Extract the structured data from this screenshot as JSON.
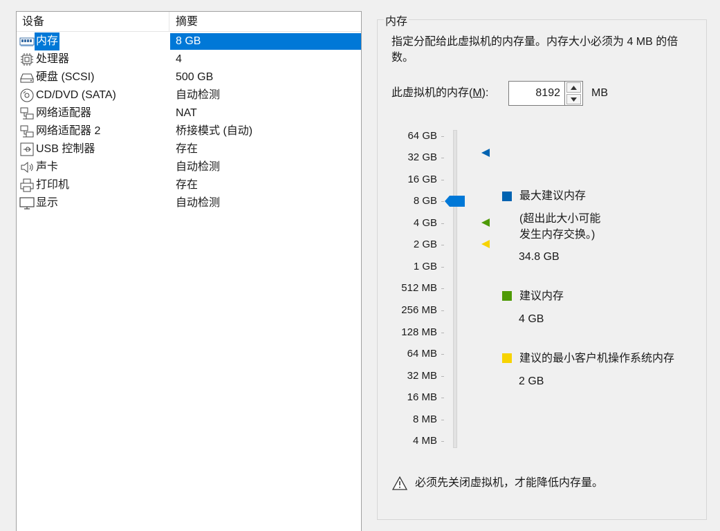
{
  "device_list": {
    "headers": {
      "device": "设备",
      "summary": "摘要"
    },
    "rows": [
      {
        "name": "内存",
        "summary": "8 GB",
        "icon": "memory-icon",
        "selected": true
      },
      {
        "name": "处理器",
        "summary": "4",
        "icon": "cpu-icon"
      },
      {
        "name": "硬盘 (SCSI)",
        "summary": "500 GB",
        "icon": "harddisk-icon"
      },
      {
        "name": "CD/DVD (SATA)",
        "summary": "自动检测",
        "icon": "cd-dvd-icon"
      },
      {
        "name": "网络适配器",
        "summary": "NAT",
        "icon": "network-adapter-icon"
      },
      {
        "name": "网络适配器 2",
        "summary": "桥接模式 (自动)",
        "icon": "network-adapter-icon"
      },
      {
        "name": "USB 控制器",
        "summary": "存在",
        "icon": "usb-icon"
      },
      {
        "name": "声卡",
        "summary": "自动检测",
        "icon": "sound-card-icon"
      },
      {
        "name": "打印机",
        "summary": "存在",
        "icon": "printer-icon"
      },
      {
        "name": "显示",
        "summary": "自动检测",
        "icon": "display-icon"
      }
    ]
  },
  "memory": {
    "group_title": "内存",
    "description": "指定分配给此虚拟机的内存量。内存大小必须为 4 MB 的倍数。",
    "label_prefix": "此虚拟机的内存(",
    "label_accel": "M",
    "label_suffix": "):",
    "value": "8192",
    "unit": "MB",
    "scale_labels": [
      "64 GB",
      "32 GB",
      "16 GB",
      "8 GB",
      "4 GB",
      "2 GB",
      "1 GB",
      "512 MB",
      "256 MB",
      "128 MB",
      "64 MB",
      "32 MB",
      "16 MB",
      "8 MB",
      "4 MB"
    ],
    "slider_value": "8 GB",
    "legend": {
      "max": {
        "title": "最大建议内存",
        "note_line1": "(超出此大小可能",
        "note_line2": "发生内存交换。)",
        "value": "34.8 GB"
      },
      "recommended": {
        "title": "建议内存",
        "value": "4 GB"
      },
      "min_guest": {
        "title": "建议的最小客户机操作系统内存",
        "value": "2 GB"
      }
    },
    "warning": "必须先关闭虚拟机，才能降低内存量。"
  },
  "colors": {
    "selection": "#0078d7",
    "max_marker": "#0063b1",
    "recommended_marker": "#4e9a06",
    "min_marker": "#f7d300"
  }
}
